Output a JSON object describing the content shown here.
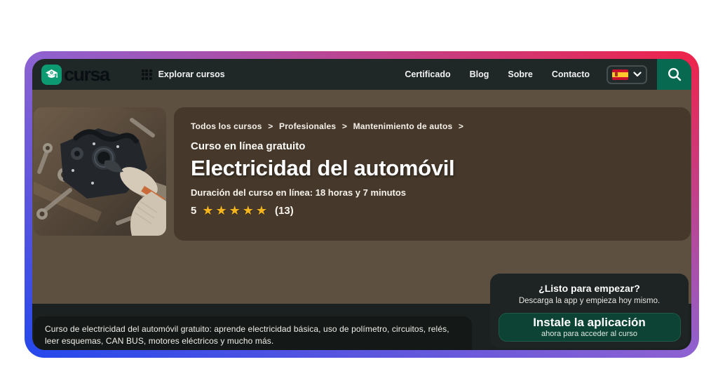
{
  "colors": {
    "frame_gradient_start": "#2448ec",
    "frame_gradient_mid": "#8e62d1",
    "frame_gradient_end": "#ef2349",
    "header_bg": "#1f2727",
    "brand_green": "#0b9a71",
    "search_green": "#086951",
    "hero_bg": "#5d5041",
    "info_panel_bg": "#46392b",
    "star_gold": "#f6b51d",
    "cta_button_green": "#0d4334"
  },
  "header": {
    "logo_text": "cursa",
    "explore_label": "Explorar cursos",
    "nav": [
      {
        "label": "Certificado"
      },
      {
        "label": "Blog"
      },
      {
        "label": "Sobre"
      },
      {
        "label": "Contacto"
      }
    ],
    "language": {
      "flag": "spain-flag"
    }
  },
  "hero": {
    "breadcrumb": {
      "items": [
        "Todos los cursos",
        "Profesionales",
        "Mantenimiento de autos"
      ],
      "separator": ">"
    },
    "course_type": "Curso en línea gratuito",
    "title": "Electricidad del automóvil",
    "duration": "Duración del curso en línea: 18 horas y 7 minutos",
    "rating": {
      "score": "5",
      "stars": "★★★★★",
      "count": "(13)"
    }
  },
  "cta": {
    "heading": "¿Listo para empezar?",
    "subheading": "Descarga la app y empieza hoy mismo.",
    "button_title": "Instale la aplicación",
    "button_subtitle": "ahora para acceder al curso"
  },
  "footer": {
    "description": "Curso de electricidad del automóvil gratuito: aprende electricidad básica, uso de polímetro, circuitos, relés, leer esquemas, CAN BUS, motores eléctricos y mucho más."
  }
}
